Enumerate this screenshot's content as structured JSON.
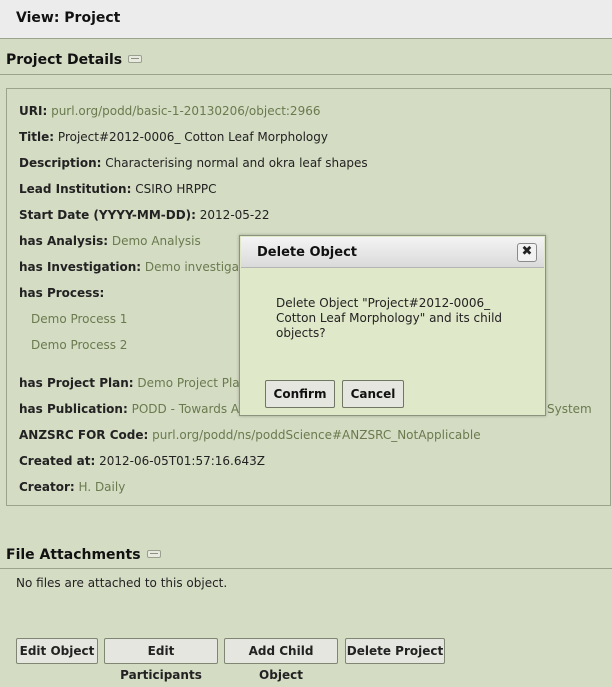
{
  "header": {
    "title": "View: Project"
  },
  "project_details": {
    "title": "Project Details",
    "uri": {
      "label": "URI:",
      "value": "purl.org/podd/basic-1-20130206/object:2966"
    },
    "title_field": {
      "label": "Title:",
      "value": "Project#2012-0006_ Cotton Leaf Morphology"
    },
    "description": {
      "label": "Description:",
      "value": "Characterising normal and okra leaf shapes"
    },
    "lead_institution": {
      "label": "Lead Institution:",
      "value": "CSIRO HRPPC"
    },
    "start_date": {
      "label": "Start Date (YYYY-MM-DD):",
      "value": "2012-05-22"
    },
    "has_analysis": {
      "label": "has Analysis:",
      "value": "Demo Analysis"
    },
    "has_investigation": {
      "label": "has Investigation:",
      "value": "Demo investigation"
    },
    "has_process": {
      "label": "has Process:",
      "items": [
        "Demo Process 1",
        "Demo Process 2"
      ]
    },
    "has_project_plan": {
      "label": "has Project Plan:",
      "value": "Demo Project Plan"
    },
    "has_publication": {
      "label": "has Publication:",
      "value": "PODD - Towards An Ex",
      "value_tail": "System"
    },
    "anzsrc": {
      "label": "ANZSRC FOR Code:",
      "value": "purl.org/podd/ns/poddScience#ANZSRC_NotApplicable"
    },
    "created_at": {
      "label": "Created at:",
      "value": "2012-06-05T01:57:16.643Z"
    },
    "creator": {
      "label": "Creator:",
      "value": "H. Daily"
    }
  },
  "attachments": {
    "title": "File Attachments",
    "empty_text": "No files are attached to this object."
  },
  "actions": {
    "edit_object": "Edit Object",
    "edit_participants": "Edit Participants",
    "add_child_object": "Add Child Object",
    "delete_project": "Delete Project"
  },
  "dialog": {
    "title": "Delete Object",
    "close_glyph": "✖",
    "message": "Delete Object \"Project#2012-0006_ Cotton Leaf Morphology\" and its child objects?",
    "confirm_label": "Confirm",
    "cancel_label": "Cancel"
  }
}
